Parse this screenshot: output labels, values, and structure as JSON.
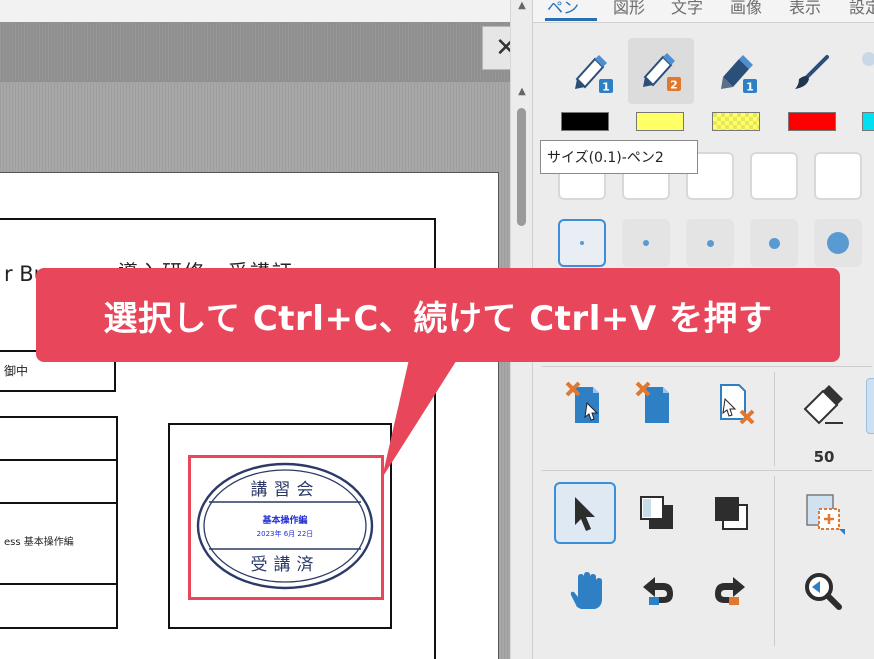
{
  "viewer": {
    "close_glyph": "✕",
    "document": {
      "title_fragment": "r Bu",
      "title_tail": "導入研修　受講証",
      "recipient_suffix": "御中",
      "course_fragment": "ess 基本操作編",
      "stamp": {
        "top_text": "講習会",
        "course": "基本操作編",
        "date": "2023年 6月 22日",
        "bottom_text": "受講済"
      }
    }
  },
  "panel": {
    "tabs": [
      {
        "label": "ペン",
        "active": true
      },
      {
        "label": "図形",
        "active": false
      },
      {
        "label": "文字",
        "active": false
      },
      {
        "label": "画像",
        "active": false
      },
      {
        "label": "表示",
        "active": false
      },
      {
        "label": "設定",
        "active": false
      }
    ],
    "pens": [
      {
        "name": "pen-1",
        "badge": "1",
        "badge_color": "#2f7fc4"
      },
      {
        "name": "pen-2",
        "badge": "2",
        "badge_color": "#e0782f"
      },
      {
        "name": "marker-1",
        "badge": "1",
        "badge_color": "#2f7fc4"
      },
      {
        "name": "brush",
        "badge": "",
        "badge_color": ""
      }
    ],
    "swatches": [
      "#000000",
      "#ffff66",
      "#ffff66",
      "#ff0000",
      "#00e0f0"
    ],
    "tooltip": "サイズ(0.1)-ペン2",
    "eraser_size": "50"
  },
  "callout": {
    "text": "選択して Ctrl+C、続けて Ctrl+V を押す",
    "color": "#e8475b"
  },
  "colors": {
    "accent": "#3b8fd8",
    "highlight": "#e8475b",
    "stamp_ink": "#2b3a67"
  }
}
